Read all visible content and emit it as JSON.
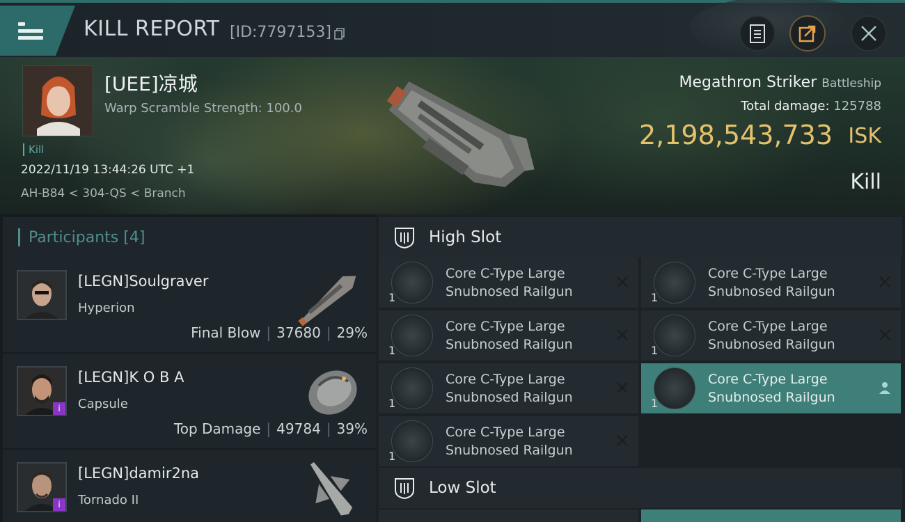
{
  "header": {
    "title": "KILL REPORT",
    "report_id": "[ID:7797153]"
  },
  "victim": {
    "name": "[UEE]凉城",
    "warp_scramble": "Warp Scramble Strength: 100.0",
    "tag": "Kill",
    "timestamp": "2022/11/19 13:44:26 UTC +1",
    "location": "AH-B84 < 304-QS < Branch",
    "ship_name": "Megathron Striker",
    "ship_class": "Battleship",
    "total_damage_label": "Total damage:",
    "total_damage_value": "125788",
    "isk_value": "2,198,543,733",
    "isk_unit": "ISK",
    "outcome": "Kill"
  },
  "participants": {
    "title": "Participants",
    "count": "[4]",
    "rows": [
      {
        "name": "[LEGN]Soulgraver",
        "ship": "Hyperion",
        "role": "Final Blow",
        "damage": "37680",
        "percent": "29%"
      },
      {
        "name": "[LEGN]K O B A",
        "ship": "Capsule",
        "role": "Top Damage",
        "damage": "49784",
        "percent": "39%"
      },
      {
        "name": "[LEGN]damir2na",
        "ship": "Tornado II"
      }
    ]
  },
  "high_slot": {
    "label": "High Slot",
    "modules": [
      {
        "name_line1": "Core C-Type Large",
        "name_line2": "Snubnosed Railgun",
        "qty": "1"
      },
      {
        "name_line1": "Core C-Type Large",
        "name_line2": "Snubnosed Railgun",
        "qty": "1"
      },
      {
        "name_line1": "Core C-Type Large",
        "name_line2": "Snubnosed Railgun",
        "qty": "1"
      },
      {
        "name_line1": "Core C-Type Large",
        "name_line2": "Snubnosed Railgun",
        "qty": "1"
      },
      {
        "name_line1": "Core C-Type Large",
        "name_line2": "Snubnosed Railgun",
        "qty": "1"
      },
      {
        "name_line1": "Core C-Type Large",
        "name_line2": "Snubnosed Railgun",
        "qty": "1"
      },
      {
        "name_line1": "Core C-Type Large",
        "name_line2": "Snubnosed Railgun",
        "qty": "1"
      }
    ]
  },
  "low_slot": {
    "label": "Low Slot"
  },
  "colors": {
    "accent": "#2d6b6a",
    "isk_gold": "#e4c26d",
    "highlight": "#3f7f7a",
    "badge": "#8a35c9"
  },
  "icons": {
    "menu": "hamburger-icon",
    "copy": "copy-icon",
    "report": "clipboard-icon",
    "share": "share-icon",
    "close": "close-icon",
    "destroyed": "x-icon",
    "dropped": "person-icon"
  }
}
